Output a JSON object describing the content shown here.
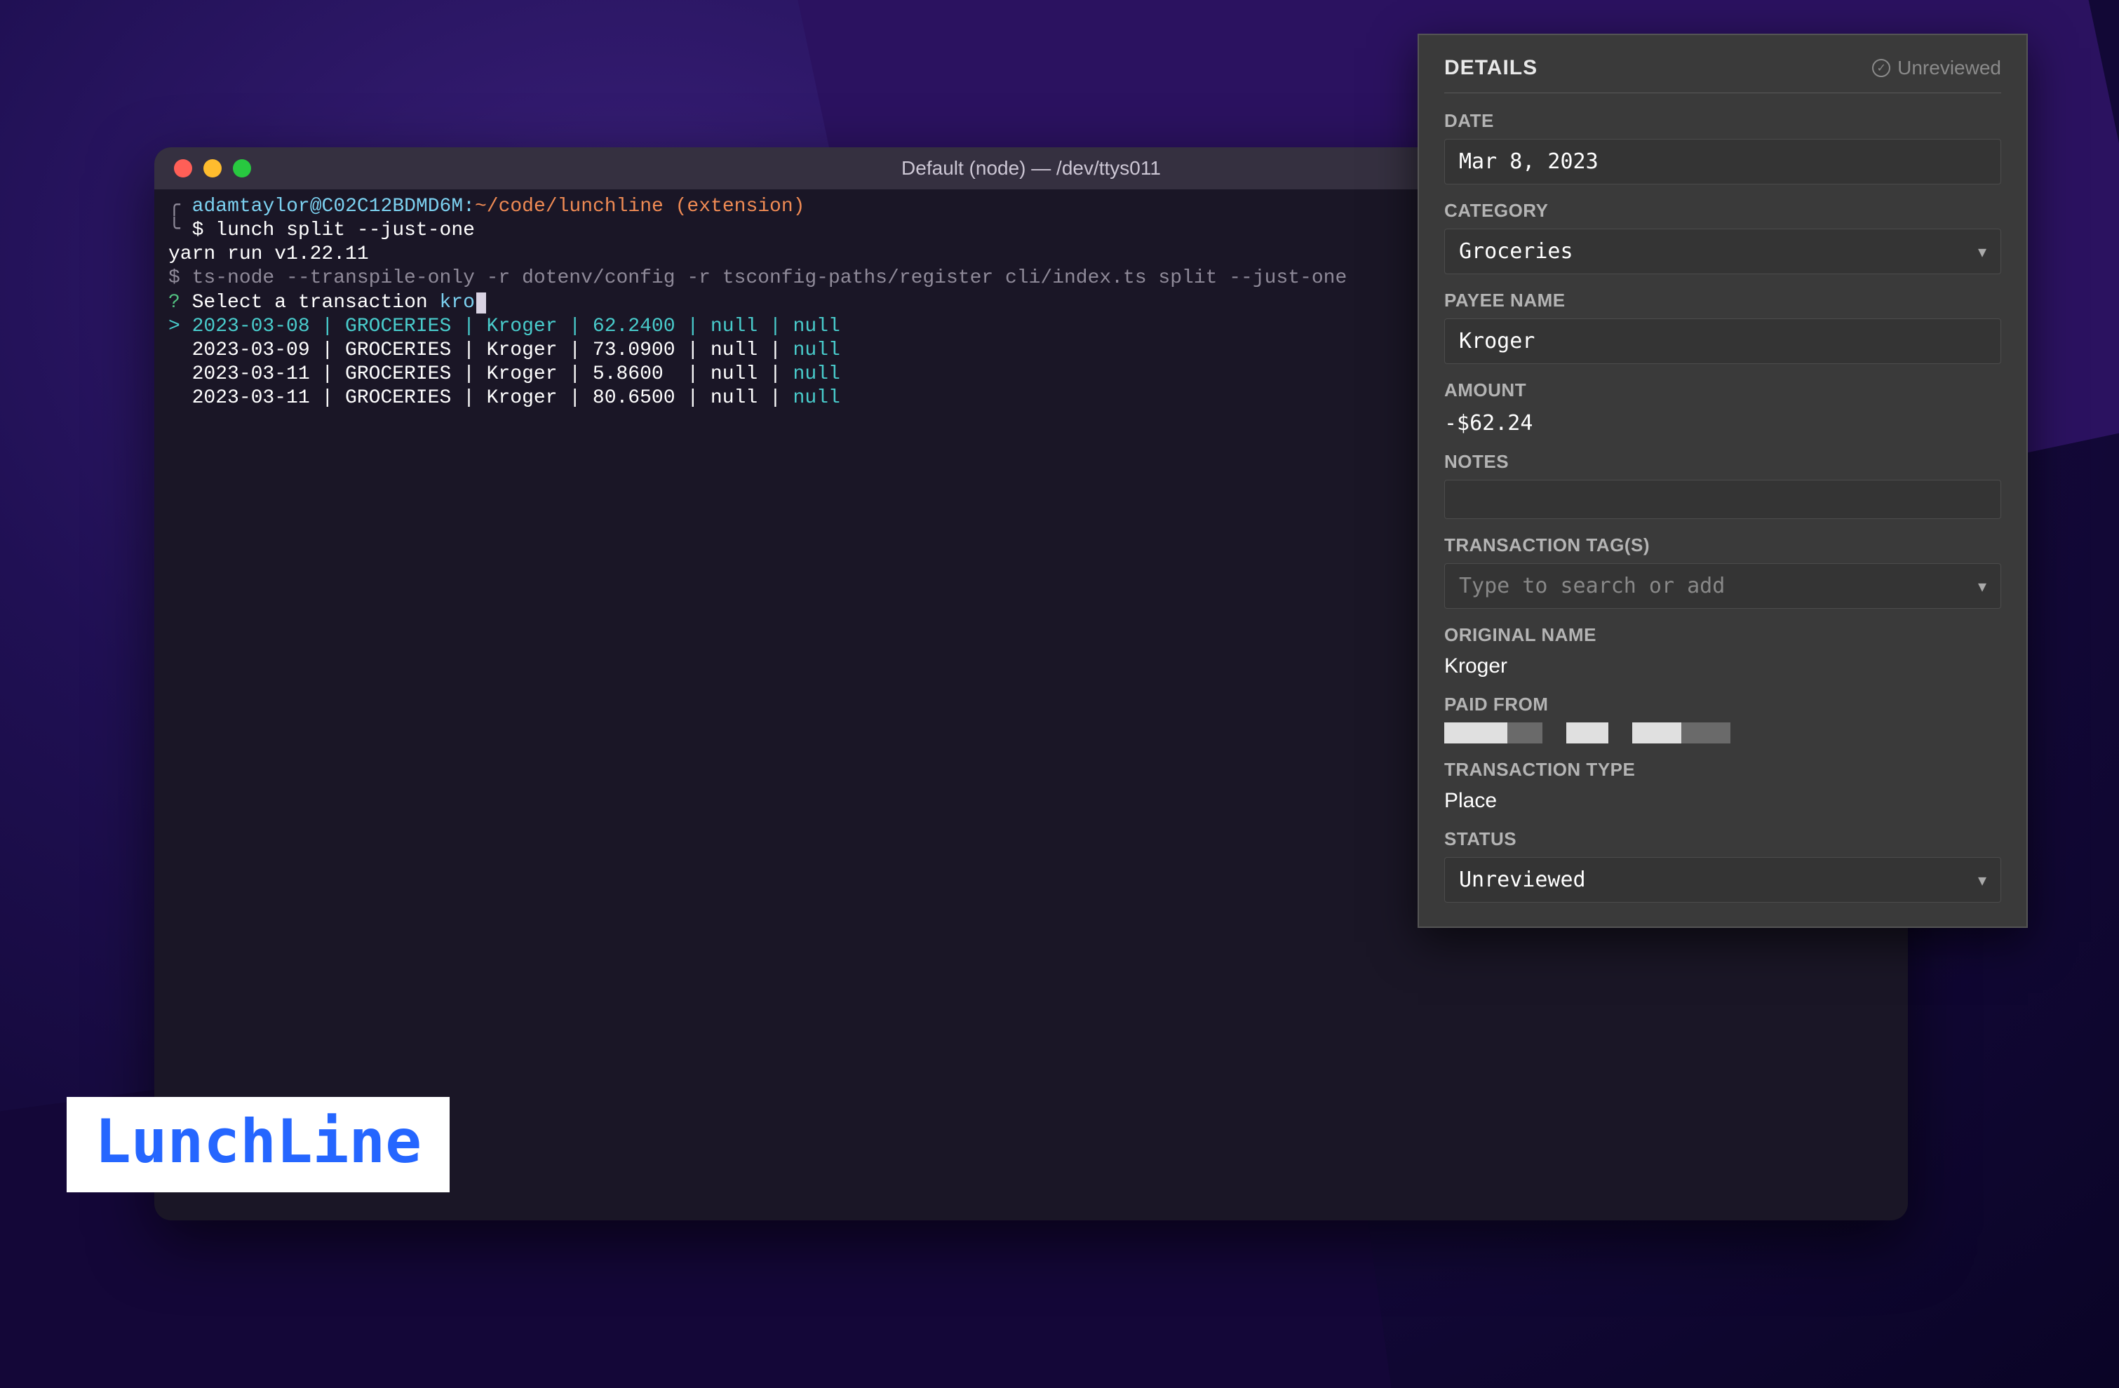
{
  "terminal": {
    "title": "Default (node) — /dev/ttys011",
    "prompt_user": "adamtaylor",
    "prompt_host": "C02C12BDMD6M",
    "prompt_path": "~/code/lunchline",
    "prompt_branch": "(extension)",
    "cmd1": "$ lunch split --just-one",
    "yarn_line": "yarn run v1.22.11",
    "tsnode_line": "$ ts-node --transpile-only -r dotenv/config -r tsconfig-paths/register cli/index.ts split --just-one",
    "prompt_question": "? Select a transaction ",
    "typed": "kro",
    "rows": [
      {
        "prefix": "> ",
        "date": "2023-03-08",
        "cat": "GROCERIES",
        "payee": "Kroger",
        "amount": "62.2400",
        "col5": "null",
        "col6": "null",
        "selected": true
      },
      {
        "prefix": "  ",
        "date": "2023-03-09",
        "cat": "GROCERIES",
        "payee": "Kroger",
        "amount": "73.0900",
        "col5": "null",
        "col6": "null",
        "selected": false
      },
      {
        "prefix": "  ",
        "date": "2023-03-11",
        "cat": "GROCERIES",
        "payee": "Kroger",
        "amount": "5.8600",
        "col5": "null",
        "col6": "null",
        "selected": false
      },
      {
        "prefix": "  ",
        "date": "2023-03-11",
        "cat": "GROCERIES",
        "payee": "Kroger",
        "amount": "80.6500",
        "col5": "null",
        "col6": "null",
        "selected": false
      }
    ]
  },
  "logo": {
    "text": "LunchLine"
  },
  "details": {
    "header": "DETAILS",
    "status_badge": "Unreviewed",
    "fields": {
      "date_label": "DATE",
      "date_value": "Mar 8, 2023",
      "category_label": "CATEGORY",
      "category_value": "Groceries",
      "payee_label": "PAYEE NAME",
      "payee_value": "Kroger",
      "amount_label": "AMOUNT",
      "amount_value": "-$62.24",
      "notes_label": "NOTES",
      "notes_value": "",
      "tags_label": "TRANSACTION TAG(S)",
      "tags_placeholder": "Type to search or add",
      "original_label": "ORIGINAL NAME",
      "original_value": "Kroger",
      "paidfrom_label": "PAID FROM",
      "type_label": "TRANSACTION TYPE",
      "type_value": "Place",
      "status_label": "STATUS",
      "status_value": "Unreviewed"
    }
  },
  "colors": {
    "accent": "#2566ff",
    "panel_bg": "#3a3a3a",
    "term_bg": "#1a1626"
  }
}
